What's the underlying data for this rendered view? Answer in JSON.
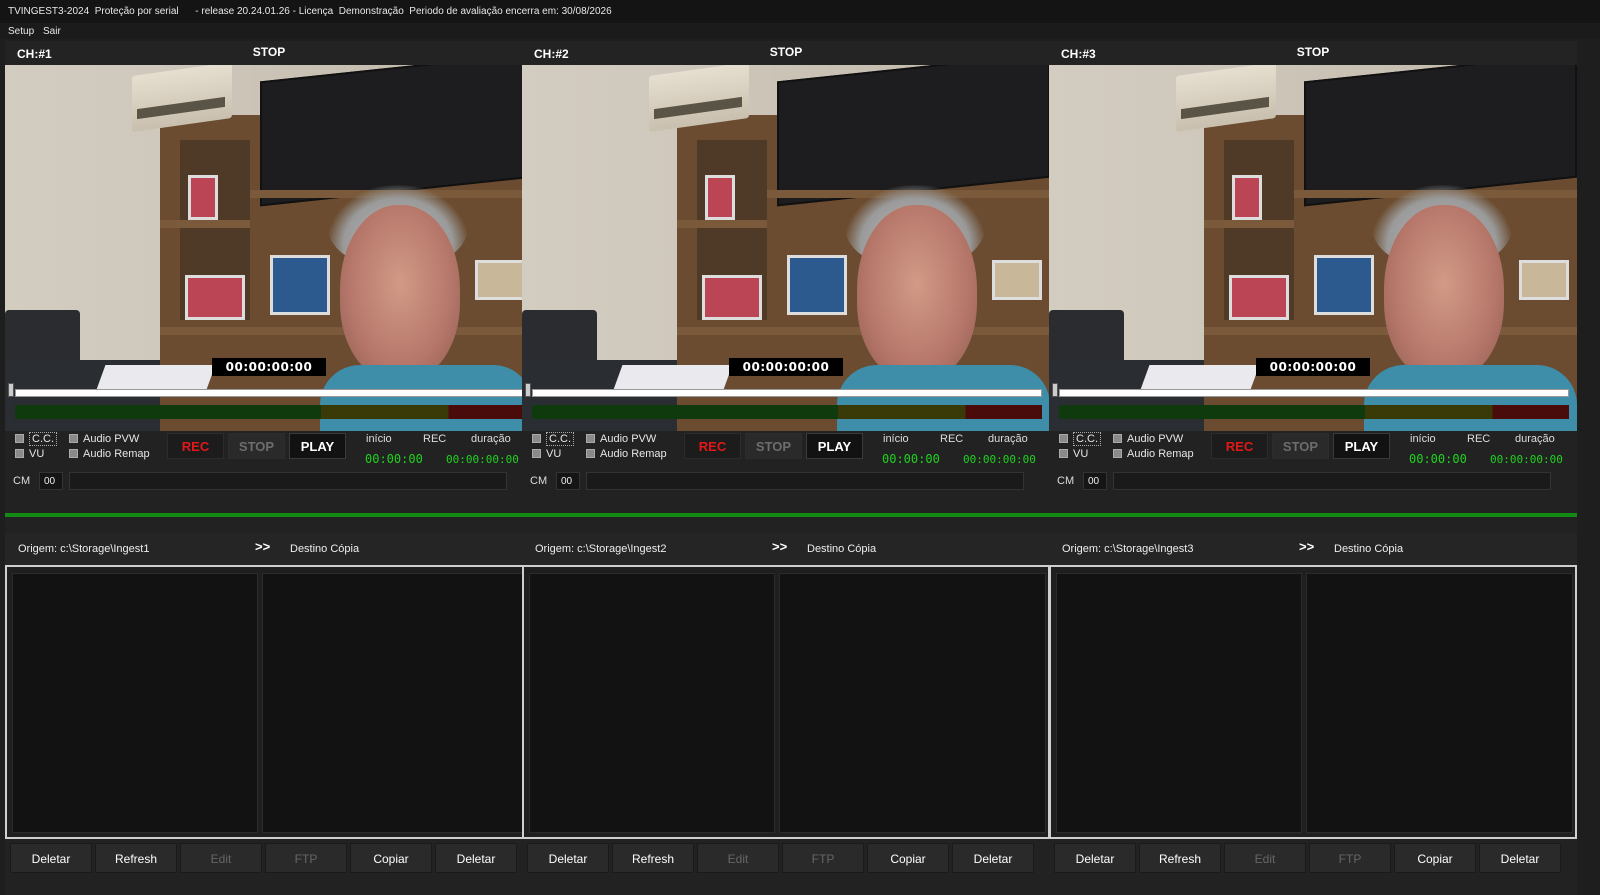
{
  "titlebar": {
    "text": "TVINGEST3-2024  Proteção por serial      - release 20.24.01.26 - Licença  Demonstração  Periodo de avaliação encerra em: 30/08/2026"
  },
  "menu": {
    "setup": "Setup",
    "sair": "Sair"
  },
  "channels": [
    {
      "label": "CH:#1",
      "state": "STOP",
      "timecode": "00:00:00:00",
      "cc": "C.C.",
      "vu": "VU",
      "audio_pvw": "Audio PVW",
      "audio_remap": "Audio Remap",
      "rec_btn": "REC",
      "stop_btn": "STOP",
      "play_btn": "PLAY",
      "inicio_label": "início",
      "rec_label": "REC",
      "duracao_label": "duração",
      "inicio_value": "00:00:00",
      "duracao_value": "00:00:00:00",
      "cm_label": "CM",
      "cm_value": "00",
      "origem": "Origem:  c:\\Storage\\Ingest1",
      "arrows": ">>",
      "destino": "Destino Cópia",
      "buttons": [
        "Deletar",
        "Refresh",
        "Edit",
        "FTP",
        "Copiar",
        "Deletar"
      ]
    },
    {
      "label": "CH:#2",
      "state": "STOP",
      "timecode": "00:00:00:00",
      "cc": "C.C.",
      "vu": "VU",
      "audio_pvw": "Audio PVW",
      "audio_remap": "Audio Remap",
      "rec_btn": "REC",
      "stop_btn": "STOP",
      "play_btn": "PLAY",
      "inicio_label": "início",
      "rec_label": "REC",
      "duracao_label": "duração",
      "inicio_value": "00:00:00",
      "duracao_value": "00:00:00:00",
      "cm_label": "CM",
      "cm_value": "00",
      "origem": "Origem:  c:\\Storage\\Ingest2",
      "arrows": ">>",
      "destino": "Destino Cópia",
      "buttons": [
        "Deletar",
        "Refresh",
        "Edit",
        "FTP",
        "Copiar",
        "Deletar"
      ]
    },
    {
      "label": "CH:#3",
      "state": "STOP",
      "timecode": "00:00:00:00",
      "cc": "C.C.",
      "vu": "VU",
      "audio_pvw": "Audio PVW",
      "audio_remap": "Audio Remap",
      "rec_btn": "REC",
      "stop_btn": "STOP",
      "play_btn": "PLAY",
      "inicio_label": "início",
      "rec_label": "REC",
      "duracao_label": "duração",
      "inicio_value": "00:00:00",
      "duracao_value": "00:00:00:00",
      "cm_label": "CM",
      "cm_value": "00",
      "origem": "Origem:  c:\\Storage\\Ingest3",
      "arrows": ">>",
      "destino": "Destino Cópia",
      "buttons": [
        "Deletar",
        "Refresh",
        "Edit",
        "FTP",
        "Copiar",
        "Deletar"
      ]
    }
  ],
  "colors": {
    "rec": "#e21818",
    "lcd": "#1fd31f",
    "status_line": "#138a13"
  }
}
